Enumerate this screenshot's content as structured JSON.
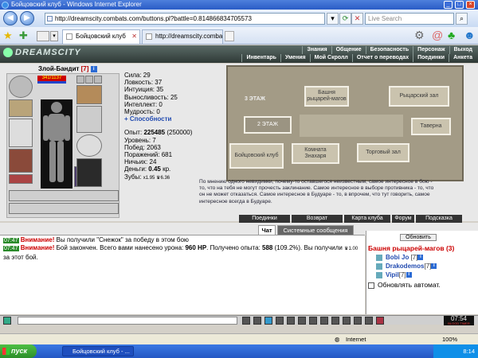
{
  "window": {
    "title": "Бойцовский клуб - Windows Internet Explorer"
  },
  "address_bar": {
    "url": "http://dreamscity.combats.com/buttons.pl?battle=0.814866834705573",
    "search_placeholder": "Live Search"
  },
  "tabs": [
    {
      "label": "Бойцовский клуб"
    },
    {
      "label": "http://dreamscity.combats.c..."
    }
  ],
  "game_header": {
    "logo": "DREAMSCITY",
    "menu_top": [
      "Знания",
      "Общение",
      "Безопасность",
      "Персонаж",
      "Выход"
    ],
    "menu_bottom": [
      "Инвентарь",
      "Умения",
      "Мой Скролл",
      "Отчет о переводах",
      "Поединки",
      "Анкета"
    ]
  },
  "character": {
    "name": "Злой-Бандит",
    "level": "[7]",
    "hp": "341/1137",
    "stats": {
      "strength": "Сила: 29",
      "agility": "Ловкость: 37",
      "intuition": "Интуиция: 35",
      "endurance": "Выносливость: 25",
      "intellect": "Интеллект: 0",
      "wisdom": "Мудрость: 0",
      "abilities_link": "+ Способности",
      "exp_label": "Опыт:",
      "exp_value": "225485",
      "exp_next": "(250000)",
      "level": "Уровень: 7",
      "wins": "Побед: 2063",
      "losses": "Поражений: 681",
      "draws": "Ничьих: 24",
      "money_label": "Деньги:",
      "money_value": "0.45",
      "money_unit": "кр.",
      "teeth_label": "Зубы:",
      "teeth_value": "x1.95 ♛6.36"
    }
  },
  "map": {
    "rooms": [
      {
        "name": "3 ЭТАЖ"
      },
      {
        "name": "Башня рыцарей-магов"
      },
      {
        "name": "Рыцарский зал"
      },
      {
        "name": "2 ЭТАЖ"
      },
      {
        "name": "Таверна"
      },
      {
        "name": "Бойцовский клуб"
      },
      {
        "name": "Комната Знахаря"
      },
      {
        "name": "Торговый зал"
      }
    ],
    "description_lines": [
      "По мнению одного невидимки, почему-то оставшегося неизвестным, самое интересное в бою -",
      "то, что на тебя не могут прочесть заклинание. Самое интересное в выборе противника - то, что",
      "он не может отказаться. Самое интересное в Будуаре - то, в впрочем, что тут говорить, самое",
      "интересное всегда в Будуаре."
    ]
  },
  "actions": [
    "Поединки",
    "Возврат",
    "Карта клуба",
    "Форум",
    "Подсказка"
  ],
  "chat": {
    "tabs": [
      "Чат",
      "Системные сообщения"
    ],
    "messages": [
      {
        "time": "07:47",
        "warn": "Внимание!",
        "text": " Вы получили \"Снежок\" за победу в этом бою"
      },
      {
        "time": "07:47",
        "warn": "Внимание!",
        "text": " Бой закончен. Всего вами нанесено урона: ",
        "bold1": "960 HP",
        "text2": ". Получено опыта: ",
        "bold2": "588",
        "text3": " (109.2%). Вы получили ",
        "small": "♛1.00",
        "text4": " за этот бой."
      }
    ]
  },
  "online": {
    "refresh_label": "Обновить",
    "room_title": "Башня рыцарей-магов (3)",
    "players": [
      {
        "name": "Bobi Jo",
        "level": "[7]"
      },
      {
        "name": "Drakodemos",
        "level": "[7]"
      },
      {
        "name": "Vipil",
        "level": "[7]"
      }
    ],
    "auto_refresh_label": "Обновлять автомат."
  },
  "clock": {
    "time": "07:54",
    "sub": "BLOOD TIMER"
  },
  "status_bar": {
    "zone": "Internet",
    "zoom": "100%"
  },
  "taskbar": {
    "start": "пуск",
    "task_item": "Бойцовский клуб - ...",
    "tray_time": "8:14"
  }
}
